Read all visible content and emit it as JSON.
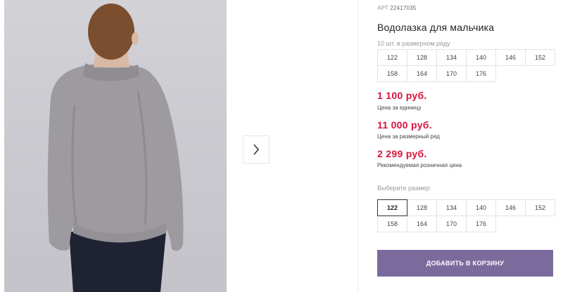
{
  "product": {
    "article_label": "АРТ",
    "article_number": "22417035",
    "title": "Водолазка для мальчика",
    "pack_note": "10 шт. в размерном ряду",
    "pack_sizes": [
      "122",
      "128",
      "134",
      "140",
      "146",
      "152",
      "158",
      "164",
      "170",
      "176"
    ]
  },
  "prices": [
    {
      "amount": "1 100 руб.",
      "label": "Цена за единицу"
    },
    {
      "amount": "11 000 руб.",
      "label": "Цена за размерный ряд"
    },
    {
      "amount": "2 299 руб.",
      "label": "Рекомендуемая розничная цена"
    }
  ],
  "size_picker": {
    "label": "Выберите размер:",
    "sizes": [
      "122",
      "128",
      "134",
      "140",
      "146",
      "152",
      "158",
      "164",
      "170",
      "176"
    ],
    "selected": "122"
  },
  "cart_button": {
    "label": "ДОБАВИТЬ В КОРЗИНУ"
  },
  "colors": {
    "price": "#d6143c",
    "button": "#7b6b9d"
  }
}
